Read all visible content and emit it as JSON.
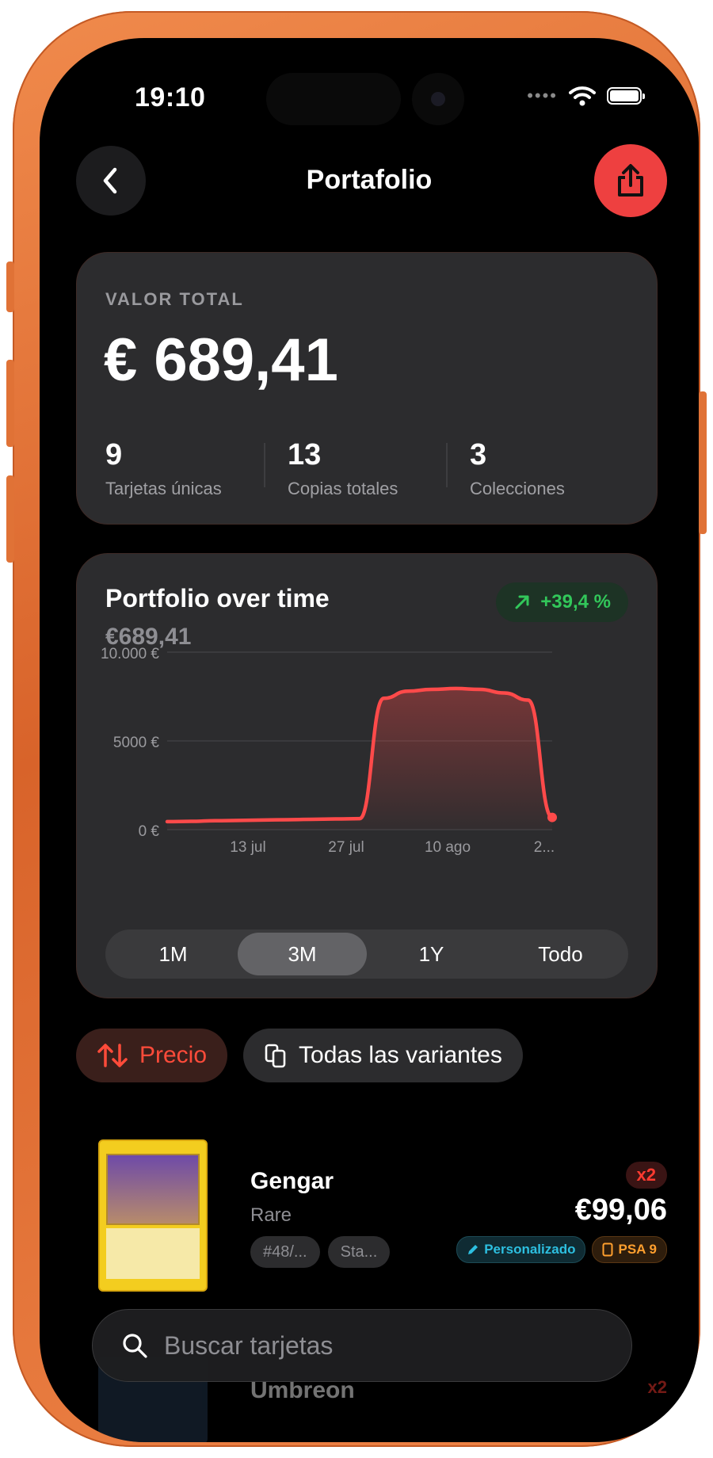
{
  "status": {
    "time": "19:10",
    "dots": "••••"
  },
  "nav": {
    "title": "Portafolio"
  },
  "total": {
    "label": "VALOR TOTAL",
    "value": "€ 689,41",
    "stats": [
      {
        "value": "9",
        "label": "Tarjetas únicas"
      },
      {
        "value": "13",
        "label": "Copias totales"
      },
      {
        "value": "3",
        "label": "Colecciones"
      }
    ]
  },
  "chart": {
    "title": "Portfolio over time",
    "subtitle": "€689,41",
    "change": "+39,4 %",
    "ranges": [
      "1M",
      "3M",
      "1Y",
      "Todo"
    ],
    "selected_range": "3M"
  },
  "chart_data": {
    "type": "area",
    "title": "Portfolio over time",
    "yticks": [
      "10.000 €",
      "5000 €",
      "0 €"
    ],
    "ytick_values": [
      10000,
      5000,
      0
    ],
    "xticks": [
      "13 jul",
      "27 jul",
      "10 ago",
      "2..."
    ],
    "ylim": [
      0,
      10000
    ],
    "grid": true,
    "color": "#ff4a4a",
    "series": [
      {
        "values": [
          450,
          470,
          500,
          520,
          540,
          560,
          580,
          600,
          620,
          7400,
          7800,
          7900,
          7950,
          7900,
          7700,
          7300,
          689
        ]
      }
    ]
  },
  "filters": {
    "sort_label": "Precio",
    "variants_label": "Todas las variantes"
  },
  "items": [
    {
      "name": "Gengar",
      "rarity": "Rare",
      "tags": [
        "#48/...",
        "Sta..."
      ],
      "qty": "x2",
      "price": "€99,06",
      "badges": {
        "custom": "Personalizado",
        "grade": "PSA 9"
      }
    },
    {
      "name": "Umbreon",
      "qty": "x2"
    }
  ],
  "search": {
    "placeholder": "Buscar tarjetas"
  },
  "colors": {
    "accent": "#ee4040",
    "positive": "#32c75a",
    "line": "#ff4a4a",
    "card": "#2c2c2e"
  }
}
